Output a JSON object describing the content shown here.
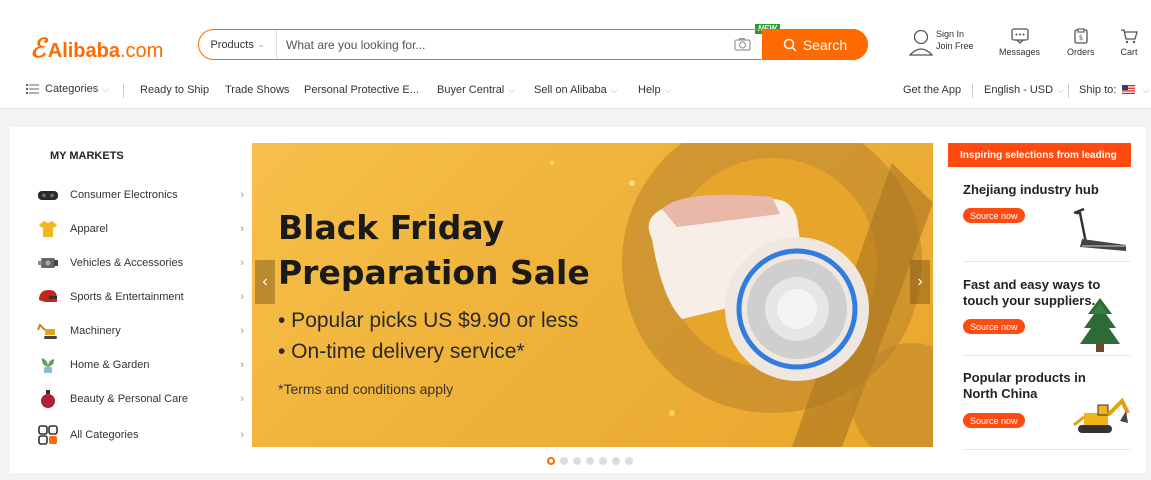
{
  "header": {
    "logo_mark": "ℰ",
    "logo_name": "Alibaba",
    "logo_suffix": ".com",
    "search": {
      "category": "Products",
      "placeholder": "What are you looking for...",
      "button_label": "Search",
      "new_badge": "NEW"
    },
    "sign_in": "Sign In",
    "join_free": "Join Free",
    "messages": "Messages",
    "orders": "Orders",
    "cart": "Cart"
  },
  "nav": {
    "categories": "Categories",
    "links": [
      "Ready to Ship",
      "Trade Shows",
      "Personal Protective E...",
      "Buyer Central",
      "Sell on Alibaba",
      "Help"
    ],
    "get_app": "Get the App",
    "language_currency": "English - USD",
    "ship_to": "Ship to:"
  },
  "markets": {
    "title": "MY MARKETS",
    "items": [
      {
        "label": "Consumer Electronics",
        "icon": "vr-headset-icon"
      },
      {
        "label": "Apparel",
        "icon": "shirt-icon"
      },
      {
        "label": "Vehicles & Accessories",
        "icon": "engine-icon"
      },
      {
        "label": "Sports & Entertainment",
        "icon": "helmet-icon"
      },
      {
        "label": "Machinery",
        "icon": "excavator-icon"
      },
      {
        "label": "Home & Garden",
        "icon": "plant-icon"
      },
      {
        "label": "Beauty & Personal Care",
        "icon": "perfume-icon"
      },
      {
        "label": "All Categories",
        "icon": "grid-icon"
      }
    ]
  },
  "banner": {
    "title_line1": "Black Friday",
    "title_line2": "Preparation Sale",
    "bullet1": "• Popular picks US $9.90 or less",
    "bullet2": "• On-time delivery service*",
    "terms": "*Terms and conditions apply",
    "slide_count": 7,
    "active_slide": 1
  },
  "right_column": {
    "header": "Inspiring selections from leading",
    "cards": [
      {
        "title": "Zhejiang industry hub",
        "button": "Source now",
        "image": "treadmill-icon"
      },
      {
        "title": "Fast and easy ways to touch your suppliers.",
        "button": "Source now",
        "image": "christmas-tree-icon"
      },
      {
        "title": "Popular products in North China",
        "button": "Source now",
        "image": "excavator-icon"
      }
    ]
  },
  "colors": {
    "brand": "#ff6a00",
    "accent_red": "#ff4b0f",
    "banner_gold": "#efb23a"
  }
}
